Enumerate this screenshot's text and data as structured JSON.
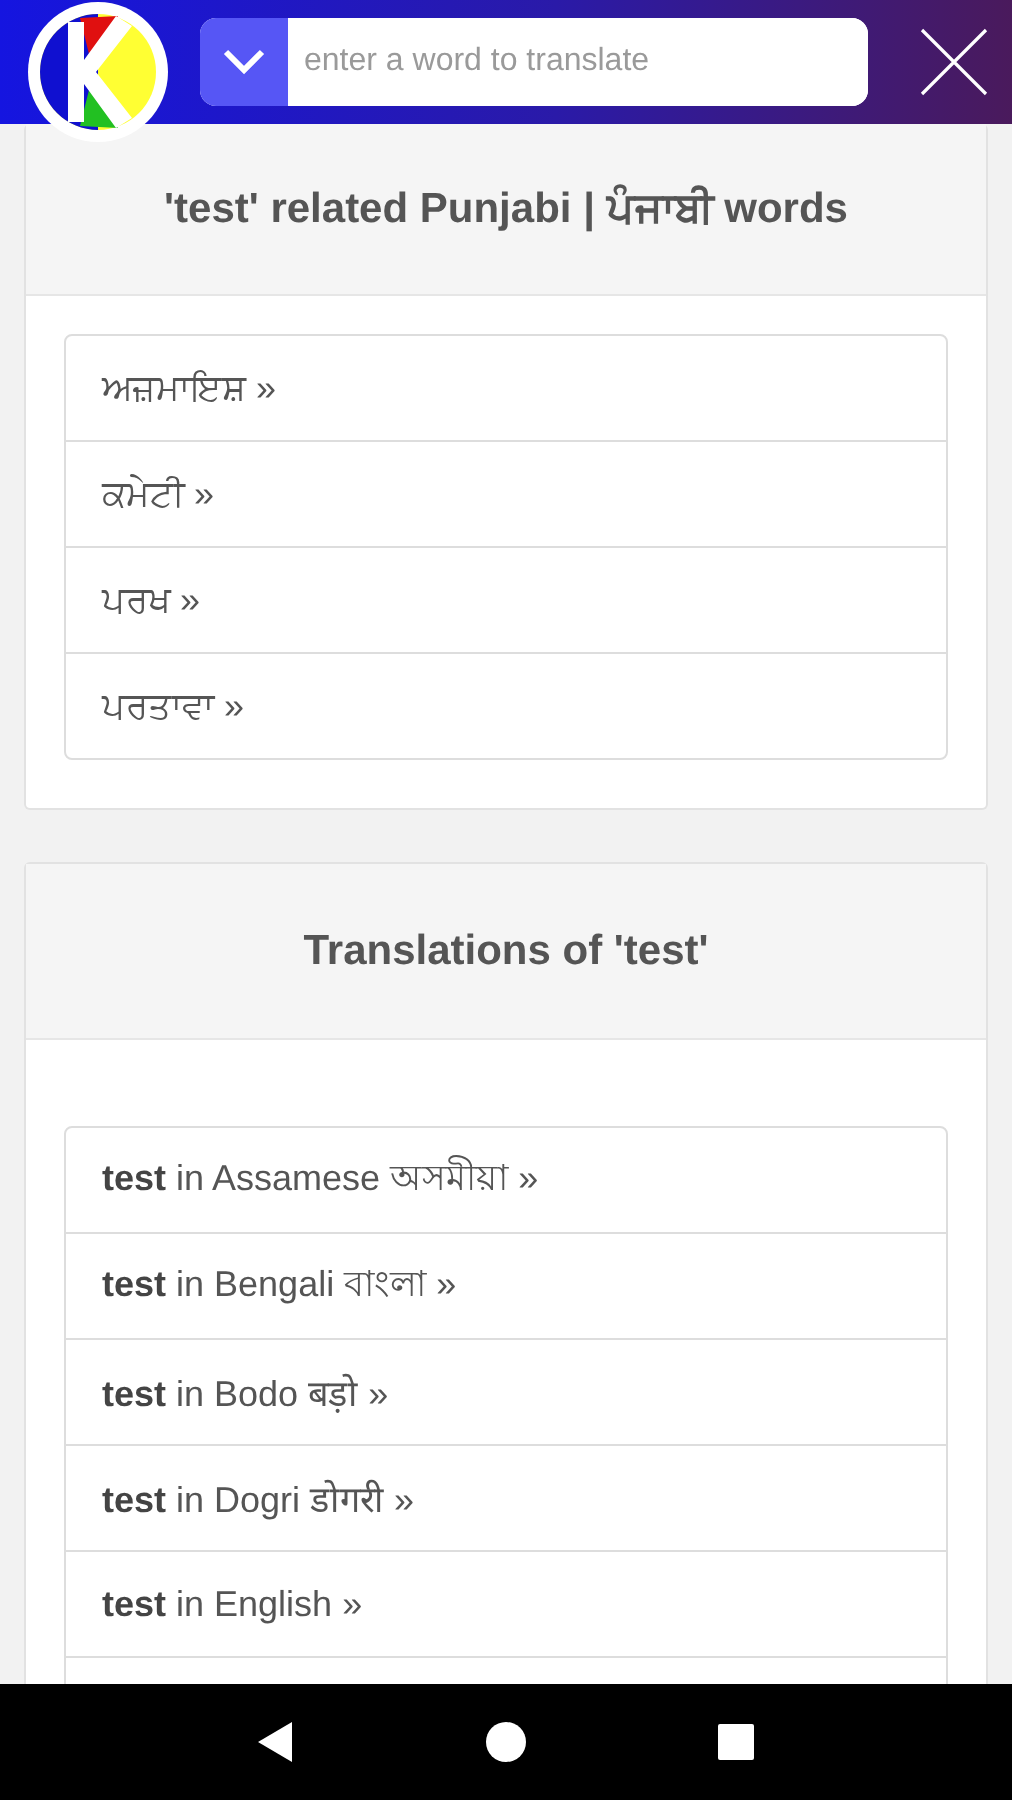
{
  "header": {
    "search": {
      "placeholder": "enter a word to translate"
    }
  },
  "related": {
    "title": "'test' related Punjabi | ਪੰਜਾਬੀ words",
    "items": [
      {
        "label": "ਅਜ਼ਮਾਇਸ਼ »"
      },
      {
        "label": "ਕਮੇਟੀ »"
      },
      {
        "label": "ਪਰਖ »"
      },
      {
        "label": "ਪਰਤਾਵਾ »"
      }
    ]
  },
  "translations": {
    "title": "Translations of 'test'",
    "items": [
      {
        "label": "**test** in Assamese অসমীয়া »"
      },
      {
        "label": "**test** in Bengali বাংলা »"
      },
      {
        "label": "**test** in Bodo बड़ो »"
      },
      {
        "label": "**test** in Dogri डोगरी »"
      },
      {
        "label": "**test** in English »"
      }
    ]
  }
}
